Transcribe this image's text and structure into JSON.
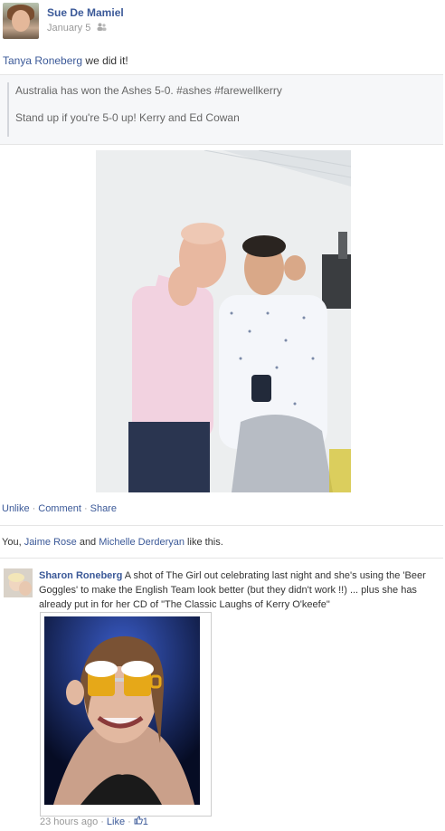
{
  "post": {
    "author": "Sue De Mamiel",
    "date": "January 5",
    "privacy_icon": "friends-icon",
    "tagged_name": "Tanya Roneberg",
    "message_rest": " we did it!",
    "shared_lines": [
      "Australia has won the Ashes 5-0. #ashes #farewellkerry",
      "Stand up if you're 5-0 up! Kerry and Ed Cowan"
    ]
  },
  "actions": {
    "unlike": "Unlike",
    "comment": "Comment",
    "share": "Share",
    "separator": "·"
  },
  "likes": {
    "prefix": "You, ",
    "person1": "Jaime Rose",
    "middle": " and ",
    "person2": "Michelle Derderyan",
    "suffix": " like this."
  },
  "comment": {
    "author": "Sharon Roneberg",
    "text": "A shot of The Girl out celebrating last night and she's using the 'Beer Goggles' to make the English Team look better (but they didn't work !!) ... plus she has already put in for her CD of \"The Classic Laughs of Kerry O'keefe\"",
    "time": "23 hours ago",
    "like_label": "Like",
    "like_count": "1",
    "like_icon": "thumbs-up-icon"
  },
  "colors": {
    "link": "#3b5998",
    "muted": "#999999",
    "share_bg": "#f6f7f9"
  }
}
